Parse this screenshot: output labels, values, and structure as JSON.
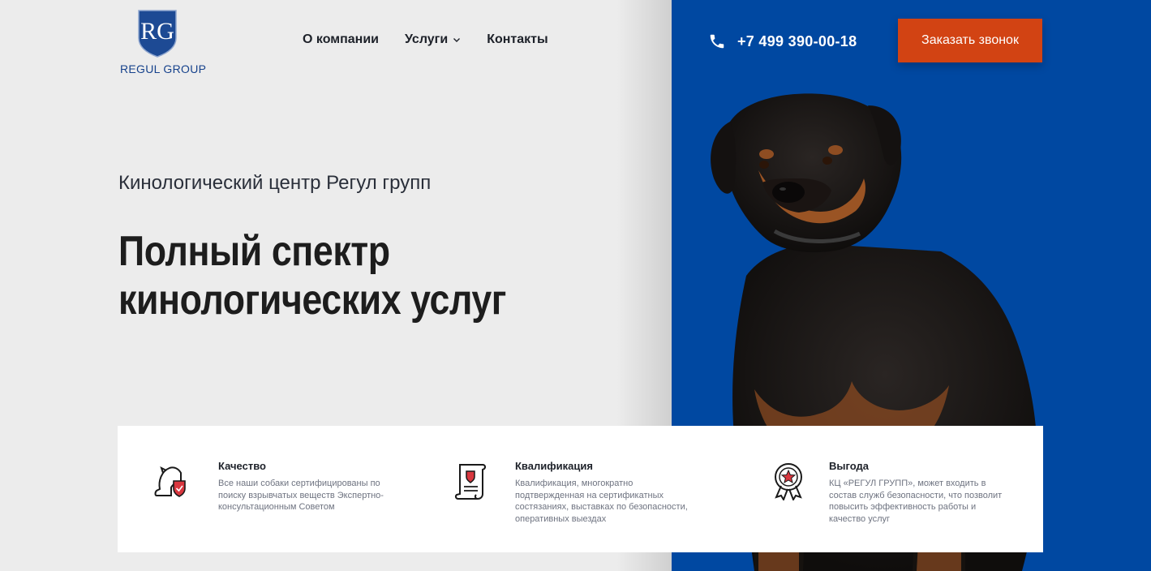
{
  "logo": {
    "initials": "RG",
    "name": "REGUL GROUP"
  },
  "nav": {
    "items": [
      {
        "label": "О компании"
      },
      {
        "label": "Услуги"
      },
      {
        "label": "Контакты"
      }
    ]
  },
  "contact": {
    "phone": "+7 499 390-00-18",
    "cta_label": "Заказать звонок"
  },
  "hero": {
    "subtitle": "Кинологический центр Регул групп",
    "title_line1": "Полный спектр",
    "title_line2": "кинологических услуг"
  },
  "features": [
    {
      "icon": "dog-shield-icon",
      "title": "Качество",
      "text": "Все наши собаки сертифицированы по поиску взрывчатых веществ Экспертно-консультационным Советом"
    },
    {
      "icon": "certificate-scroll-icon",
      "title": "Квалификация",
      "text": "Квалификация, многократно подтвержденная на сертификатных состязаниях, выставках по безопасности, оперативных выездах"
    },
    {
      "icon": "award-medal-icon",
      "title": "Выгода",
      "text": "КЦ «РЕГУЛ ГРУПП», может входить в состав служб безопасности, что позволит повысить эффективность работы и качество услуг"
    }
  ],
  "colors": {
    "brand_blue": "#0048a1",
    "accent": "#d24313",
    "background": "#ececec"
  }
}
